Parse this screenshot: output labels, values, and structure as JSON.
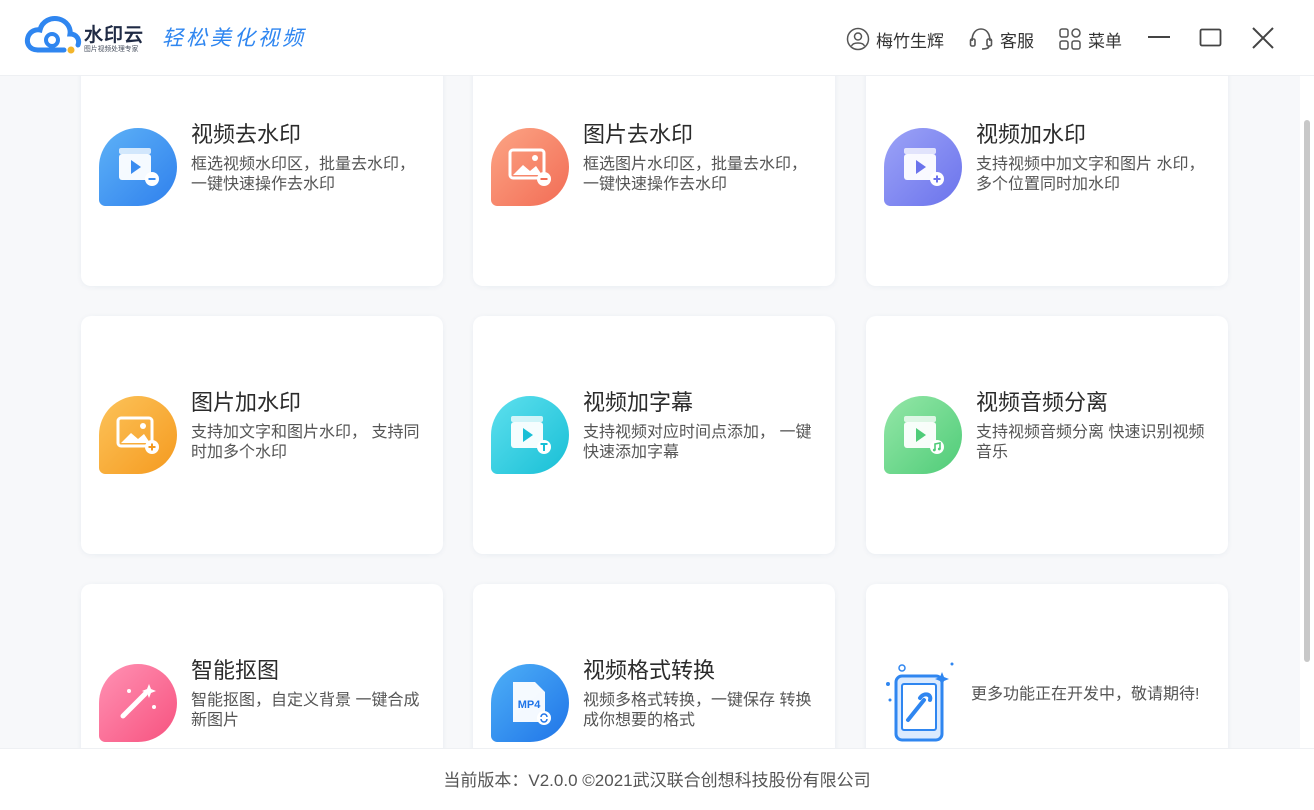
{
  "header": {
    "brand_name": "水印云",
    "brand_sub": "图片视频处理专家",
    "slogan": "轻松美化视频",
    "user_label": "梅竹生辉",
    "service_label": "客服",
    "menu_label": "菜单"
  },
  "cards": [
    {
      "title": "视频去水印",
      "desc": "框选视频水印区，批量去水印， 一键快速操作去水印",
      "icon": "video-remove-icon",
      "color": "#3b8ff0"
    },
    {
      "title": "图片去水印",
      "desc": "框选图片水印区，批量去水印， 一键快速操作去水印",
      "icon": "image-remove-icon",
      "color": "#f7866a"
    },
    {
      "title": "视频加水印",
      "desc": "支持视频中加文字和图片 水印，多个位置同时加水印",
      "icon": "video-add-icon",
      "color": "#7c83f0"
    },
    {
      "title": "图片加水印",
      "desc": "支持加文字和图片水印， 支持同时加多个水印",
      "icon": "image-add-icon",
      "color": "#f8ad3a"
    },
    {
      "title": "视频加字幕",
      "desc": "支持视频对应时间点添加， 一键快速添加字幕",
      "icon": "video-subtitle-icon",
      "color": "#2dcde0"
    },
    {
      "title": "视频音频分离",
      "desc": "支持视频音频分离 快速识别视频音乐",
      "icon": "video-audio-icon",
      "color": "#6fd98d"
    },
    {
      "title": "智能抠图",
      "desc": "智能抠图，自定义背景 一键合成新图片",
      "icon": "magic-wand-icon",
      "color": "#fb6f99"
    },
    {
      "title": "视频格式转换",
      "desc": "视频多格式转换，一键保存 转换成你想要的格式",
      "icon": "mp4-convert-icon",
      "color": "#2f86f0"
    },
    {
      "title": "",
      "desc": "更多功能正在开发中，敬请期待!",
      "icon": "developing-phone-icon",
      "color": "#3b8ff0"
    }
  ],
  "footer": {
    "text": "当前版本：V2.0.0 ©2021武汉联合创想科技股份有限公司"
  }
}
